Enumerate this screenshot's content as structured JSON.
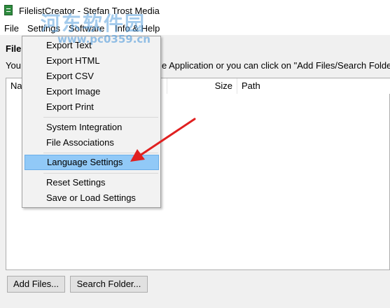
{
  "window": {
    "title": "FilelistCreator - Stefan Trost Media"
  },
  "menubar": {
    "file": "File",
    "settings": "Settings",
    "software": "Software",
    "info_help": "Info & Help"
  },
  "main": {
    "heading": "File",
    "hint_left": "You",
    "hint_right": "e Application or you can click on \"Add Files/Search Folde",
    "columns": {
      "name": "Na",
      "size": "Size",
      "path": "Path"
    },
    "buttons": {
      "add_files": "Add Files...",
      "search_folder": "Search Folder..."
    }
  },
  "dropdown": {
    "items": [
      "Export Text",
      "Export HTML",
      "Export CSV",
      "Export Image",
      "Export Print",
      "System Integration",
      "File Associations",
      "Language Settings",
      "Reset Settings",
      "Save or Load Settings"
    ],
    "highlighted_item": "Language Settings"
  },
  "overlay": {
    "watermark_text": "河东软件园",
    "watermark_url": "www.pc0359.cn",
    "arrow_color": "#e02020"
  },
  "colors": {
    "highlight": "#91c9f7",
    "menu_bg": "#f2f2f2"
  }
}
